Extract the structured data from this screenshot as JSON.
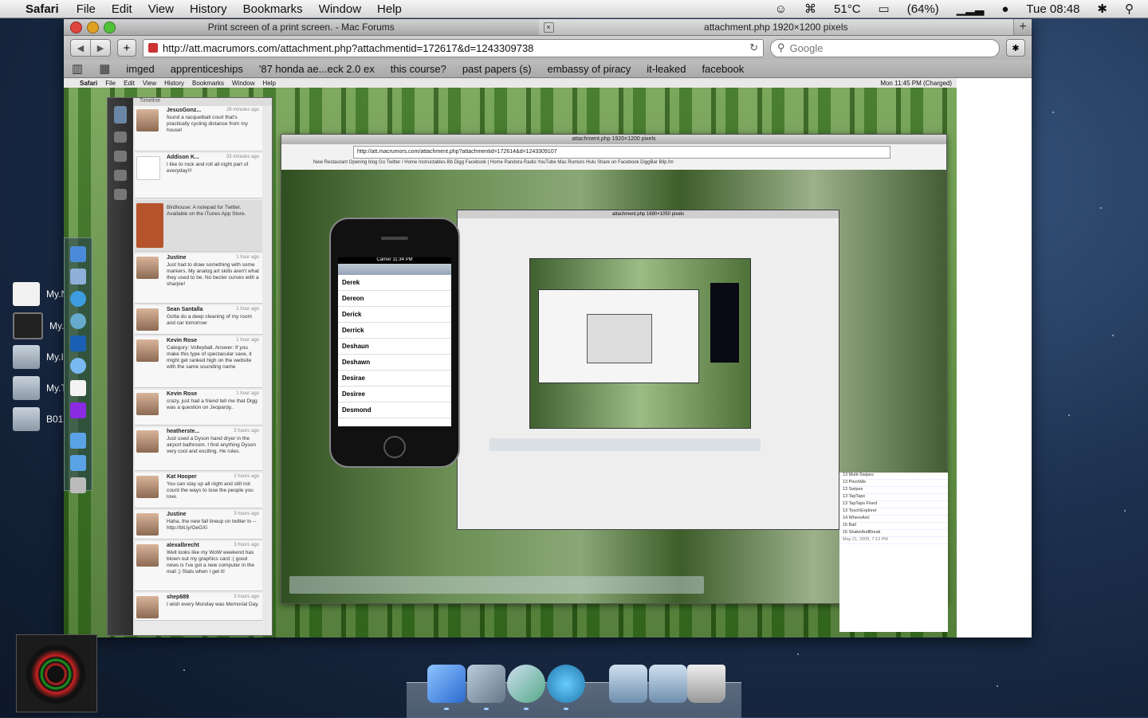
{
  "menubar": {
    "app": "Safari",
    "items": [
      "File",
      "Edit",
      "View",
      "History",
      "Bookmarks",
      "Window",
      "Help"
    ],
    "temperature": "51°C",
    "battery": "(64%)",
    "clock": "Tue 08:48"
  },
  "desktop": {
    "items": [
      {
        "label": "My.N"
      },
      {
        "label": "My.I"
      },
      {
        "label": "My.I"
      },
      {
        "label": "My.T"
      },
      {
        "label": "B01"
      }
    ]
  },
  "window": {
    "tabs": [
      {
        "title": "Print screen of a print screen. - Mac Forums",
        "active": false
      },
      {
        "title": "attachment.php 1920×1200 pixels",
        "active": true
      }
    ],
    "url": "http://att.macrumors.com/attachment.php?attachmentid=172617&d=1243309738",
    "search_placeholder": "Google",
    "bookmarks": [
      "imged",
      "apprenticeships",
      "'87 honda ae...eck 2.0 ex",
      "this course?",
      "past papers (s)",
      "embassy of piracy",
      "it-leaked",
      "facebook"
    ]
  },
  "screenshot": {
    "menubar": {
      "app": "Safari",
      "items": [
        "File",
        "Edit",
        "View",
        "History",
        "Bookmarks",
        "Window",
        "Help"
      ],
      "clock": "Mon 11:45 PM",
      "battery": "(Charged)"
    },
    "twitter": {
      "header": "Timeline",
      "tweets": [
        {
          "name": "JesusGonz...",
          "time": "28 minutes ago",
          "text": "found a racquetball court that's practically cycling distance from my house!"
        },
        {
          "name": "Addison K...",
          "time": "33 minutes ago",
          "text": "I like to rock and roll all night part of everyday!!!"
        },
        {
          "name": "Birdhouse",
          "time": "",
          "text": "Birdhouse: A notepad for Twitter. Available on the iTunes App Store."
        },
        {
          "name": "Justine",
          "time": "1 hour ago",
          "text": "Just had to draw something with some markers. My analog art skills aren't what they used to be. No bezier curves with a sharpie!"
        },
        {
          "name": "Sean Santalla",
          "time": "1 hour ago",
          "text": "Gotta do a deep cleaning of my room and car tomorrow"
        },
        {
          "name": "Kevin Rose",
          "time": "1 hour ago",
          "text": "Category: Volleyball, Answer: If you make this type of spectacular save, it might get ranked high on the website with the same sounding name"
        },
        {
          "name": "Kevin Rose",
          "time": "1 hour ago",
          "text": "crazy, just had a friend tell me that Digg was a question on Jeopardy.."
        },
        {
          "name": "heatherste...",
          "time": "2 hours ago",
          "text": "Just used a Dyson hand dryer in the airport bathroom. I find anything Dyson very cool and exciting. He rules."
        },
        {
          "name": "Kat Hooper",
          "time": "2 hours ago",
          "text": "You can stay up all night and still not count the ways to lose the people you love."
        },
        {
          "name": "Justine",
          "time": "3 hours ago",
          "text": "Haha, the new fall lineup on twitter tv -- http://bit.ly/OeGXi"
        },
        {
          "name": "alexalbrecht",
          "time": "3 hours ago",
          "text": "Well looks like my WoW weekend has blown out my graphics card :( good news is I've got a new computer in the mail ;) Stats when I get it!"
        },
        {
          "name": "shep689",
          "time": "3 hours ago",
          "text": "I wish every Monday was Memorial Day."
        }
      ]
    },
    "nested_window": {
      "title": "attachment.php 1920×1200 pixels",
      "url": "http://att.macrumors.com/attachment.php?attachmentid=172614&d=1243309107",
      "bookmarks": "New Restaurant Opening   blog   Go   Twitter / Home   Instructables   Bb   Digg   Facebook | Home   Pandora Radio   YouTube   Mac Rumors   Hulu   Share on Facebook   DiggBar   Blip.fm"
    },
    "iphone": {
      "carrier": "Carrier",
      "time": "11:34 PM",
      "names": [
        "Derek",
        "Dereon",
        "Derick",
        "Derrick",
        "Deshaun",
        "Deshawn",
        "Desirae",
        "Desiree",
        "Desmond"
      ]
    },
    "inner_window": {
      "title": "attachment.php 1680×1050 pixels"
    },
    "finder_items": [
      "13 Multi-Swipes",
      "13 PinchMe",
      "13 Swipes",
      "13 TapTaps",
      "13 TapTaps Fixed",
      "13 TouchExplorer",
      "14 WhereAmI",
      "15 Ball",
      "15 ShakeAndBreak"
    ],
    "finder_dates": "May 21, 2009, 7:13 PM"
  },
  "dock": {
    "items": [
      "Finder",
      "iPhoto",
      "iTunes",
      "Safari",
      "Applications",
      "Reebok",
      "Trash"
    ]
  },
  "colors": {
    "menubar": "#e4e4e4",
    "chrome": "#c4c4c4",
    "desktop": "#1d3150"
  }
}
